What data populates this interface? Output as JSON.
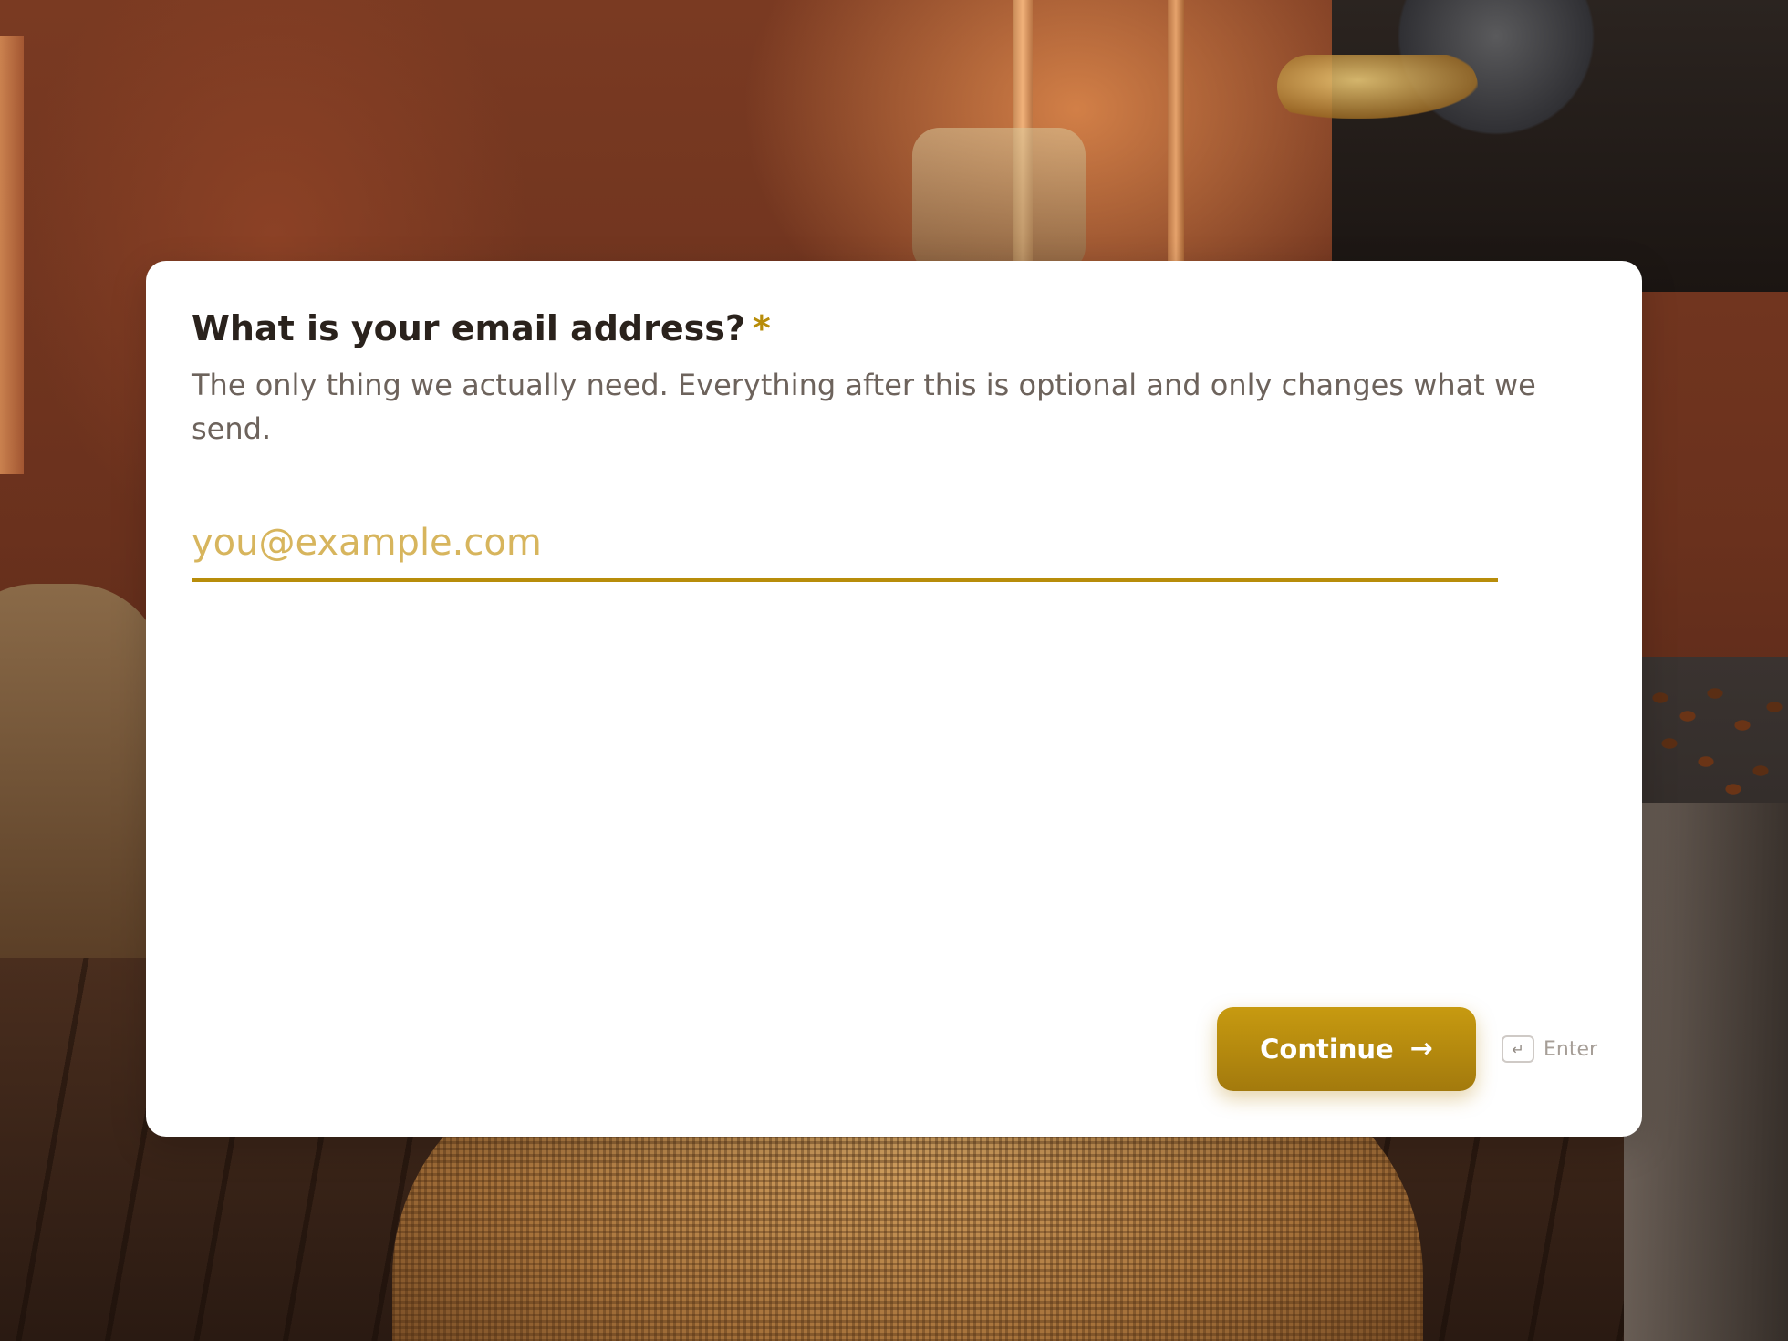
{
  "form": {
    "question": "What is your email address?",
    "required_marker": "*",
    "description": "The only thing we actually need. Everything after this is optional and only changes what we send.",
    "email": {
      "value": "",
      "placeholder": "you@example.com"
    },
    "continue_label": "Continue",
    "continue_icon": "arrow-right-icon",
    "enter_key_icon": "return-key-icon",
    "enter_hint_label": "Enter"
  },
  "colors": {
    "accent": "#b88d0a",
    "placeholder": "#d7b55d",
    "button_text": "#ffffff",
    "heading": "#2a221c",
    "description": "#6d635c"
  },
  "background": {
    "scene": "coffee roastery with burlap sack, roaster, and beans"
  }
}
